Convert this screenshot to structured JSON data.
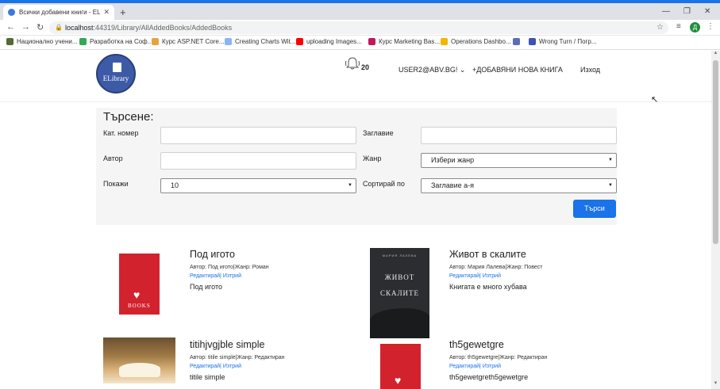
{
  "browser": {
    "tab_title": "Всички добавени книги - ELibrary",
    "url_host": "localhost",
    "url_path": ":44319/Library/AllAddedBooks/AddedBooks",
    "profile_initial": "Д",
    "bookmarks": [
      {
        "label": "Национално учени...",
        "icon_color": "#556b2f"
      },
      {
        "label": "Разработка на Соф...",
        "icon_color": "#34a853"
      },
      {
        "label": "Курс ASP.NET Core...",
        "icon_color": "#e8a33d"
      },
      {
        "label": "Creating Charts Wit...",
        "icon_color": "#8ab4f8"
      },
      {
        "label": "uploading Images...",
        "icon_color": "#ff0000"
      },
      {
        "label": "Курс Marketing Bas...",
        "icon_color": "#c2185b"
      },
      {
        "label": "Operations Dashbo...",
        "icon_color": "#f4b400"
      },
      {
        "label": "",
        "icon_color": "#5c6bc0"
      },
      {
        "label": "Wrong Turn / Погр...",
        "icon_color": "#3f51b5"
      }
    ]
  },
  "header": {
    "logo_text": "ELibrary",
    "notification_count": "20",
    "user": "USER2@ABV.BG!",
    "add_book": "+ДОБАВЯНИ НОВА КНИГА",
    "logout": "Изход"
  },
  "search": {
    "title": "Търсене:",
    "catalog_label": "Кат. номер",
    "title_label": "Заглавие",
    "author_label": "Автор",
    "genre_label": "Жанр",
    "genre_value": "Избери жанр",
    "show_label": "Покажи",
    "show_value": "10",
    "sort_label": "Сортирай по",
    "sort_value": "Заглавие а-я",
    "submit": "Търси"
  },
  "books": [
    {
      "title": "Под игото",
      "meta": "Автор: Под игото|Жанр: Роман",
      "edit": "Редактирай",
      "delete": "Изтрий",
      "desc": "Под игото",
      "cover": "I ♥ BOOKS"
    },
    {
      "title": "Живот в скалите",
      "meta": "Автор: Мария Лалева|Жанр: Повест",
      "edit": "Редактирай",
      "delete": "Изтрий",
      "desc": "Книгата е много хубава",
      "cover_author": "МАРИЯ ЛАЛЕВА",
      "cover_t1": "ЖИВОТ",
      "cover_t2": "СКАЛИТЕ"
    },
    {
      "title": "titihjvgjble simple",
      "meta": "Автор: titile simple|Жанр: Редактиран",
      "edit": "Редактирай",
      "delete": "Изтрий",
      "desc": "titile simple"
    },
    {
      "title": "th5gewetgre",
      "meta": "Автор: th5gewetgre|Жанр: Редактиран",
      "edit": "Редактирай",
      "delete": "Изтрий",
      "desc": "th5gewetgreth5gewetgre"
    }
  ]
}
